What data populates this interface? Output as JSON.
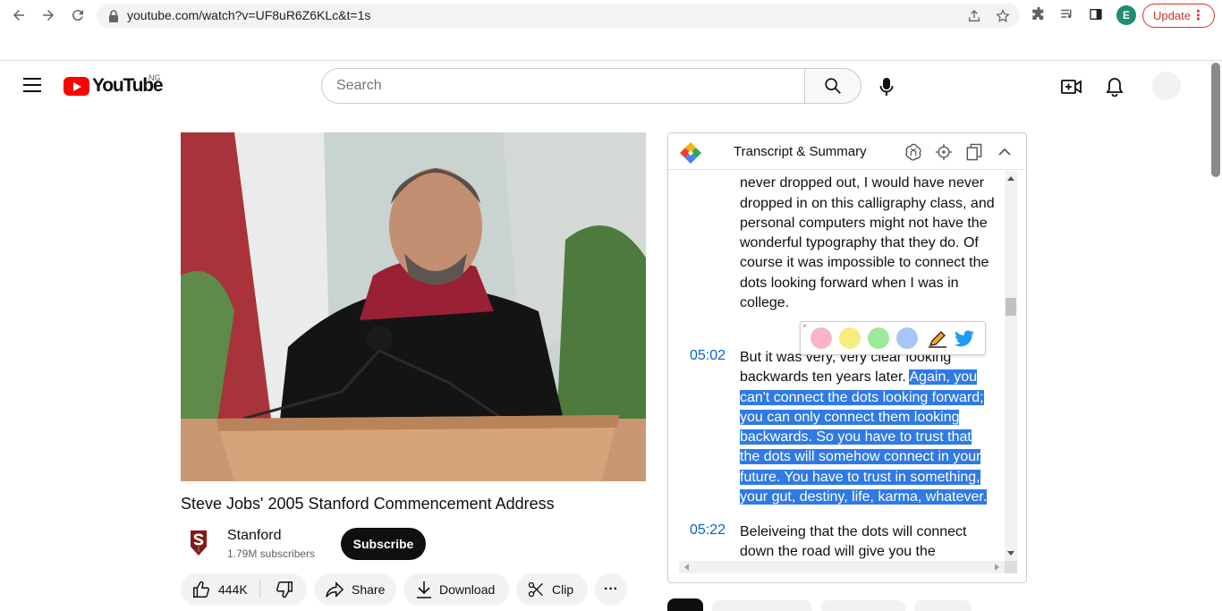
{
  "browser": {
    "url": "youtube.com/watch?v=UF8uR6Z6KLc&t=1s",
    "profile_initial": "E",
    "update_label": "Update",
    "update_menu": "⋮"
  },
  "youtube": {
    "logo_text": "YouTube",
    "region": "NG",
    "search_placeholder": "Search"
  },
  "video": {
    "title": "Steve Jobs' 2005 Stanford Commencement Address",
    "channel": "Stanford",
    "subscribers": "1.79M subscribers",
    "subscribe_label": "Subscribe",
    "like_count": "444K",
    "share_label": "Share",
    "download_label": "Download",
    "clip_label": "Clip",
    "more_label": "···"
  },
  "panel": {
    "title": "Transcript & Summary",
    "segments": [
      {
        "time": "",
        "text": "computer would have them. If I had never dropped out, I would have never dropped in on this calligraphy class, and personal computers might not have the wonderful typography that they do. Of course it was impossible to connect the dots looking forward when I was in college."
      },
      {
        "time": "05:02",
        "text_before": "But it was very, very clear looking backwards ten years later. ",
        "text_selected": "Again, you can't connect the dots looking forward; you can only connect them looking backwards. So you have to trust that the dots will somehow connect in your future. You have to trust in something, your gut, destiny, life, karma, whatever."
      },
      {
        "time": "05:22",
        "text": "Beleiveing that the dots will connect down the road will give you the"
      }
    ],
    "highlight_colors": [
      "#f9b4c8",
      "#f5ee7e",
      "#9ee89a",
      "#a9c4f7"
    ],
    "popup_close": "×"
  }
}
